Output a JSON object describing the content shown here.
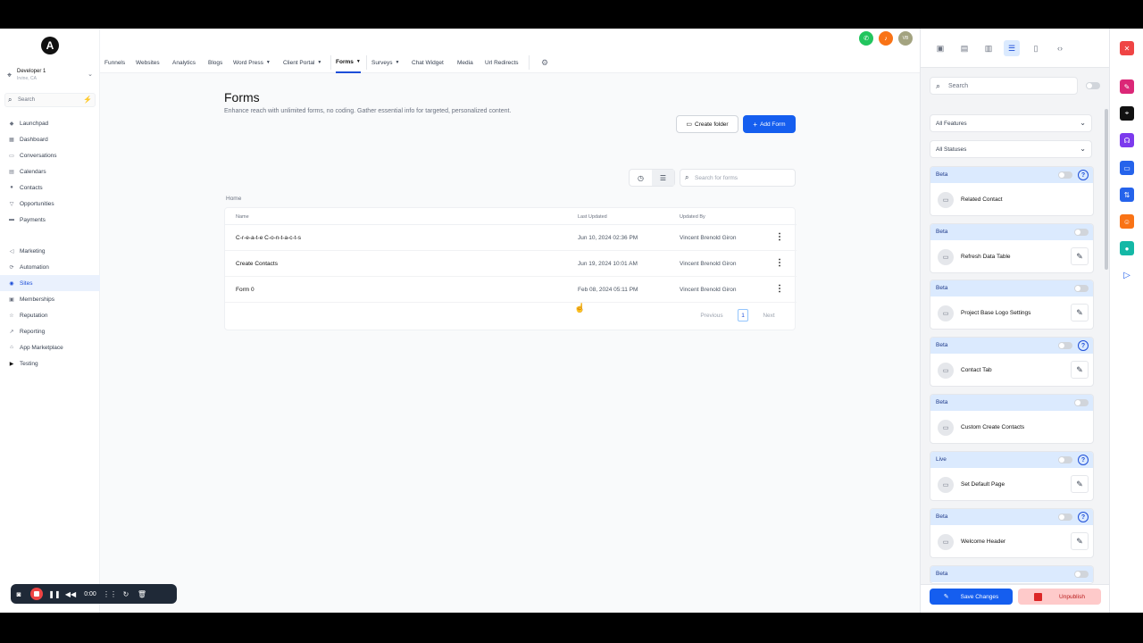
{
  "app": {
    "logo": "A"
  },
  "location": {
    "name": "Developer 1",
    "sub": "Irvine, CA"
  },
  "sidebar": {
    "search_placeholder": "Search",
    "items_top": [
      {
        "label": "Launchpad",
        "icon": "rocket-icon"
      },
      {
        "label": "Dashboard",
        "icon": "dashboard-icon"
      },
      {
        "label": "Conversations",
        "icon": "chat-icon"
      },
      {
        "label": "Calendars",
        "icon": "calendar-icon"
      },
      {
        "label": "Contacts",
        "icon": "contacts-icon"
      },
      {
        "label": "Opportunities",
        "icon": "filter-icon"
      },
      {
        "label": "Payments",
        "icon": "card-icon"
      }
    ],
    "items_bottom": [
      {
        "label": "Marketing",
        "icon": "megaphone-icon"
      },
      {
        "label": "Automation",
        "icon": "automation-icon"
      },
      {
        "label": "Sites",
        "icon": "globe-icon",
        "active": true
      },
      {
        "label": "Memberships",
        "icon": "members-icon"
      },
      {
        "label": "Reputation",
        "icon": "star-icon"
      },
      {
        "label": "Reporting",
        "icon": "chart-icon"
      },
      {
        "label": "App Marketplace",
        "icon": "store-icon"
      },
      {
        "label": "Testing",
        "icon": "youtube-icon"
      }
    ]
  },
  "topnav": {
    "items": [
      "Funnels",
      "Websites",
      "Analytics",
      "Blogs",
      "Word Press",
      "Client Portal",
      "Forms",
      "Surveys",
      "Chat Widget",
      "Media",
      "Url Redirects"
    ],
    "active": "Forms",
    "user_initials": "VB"
  },
  "main": {
    "title": "Forms",
    "subtitle": "Enhance reach with unlimited forms, no coding. Gather essential info for targeted, personalized content.",
    "create_folder": "Create folder",
    "add_form": "Add Form",
    "search_placeholder": "Search for forms",
    "breadcrumb": "Home",
    "columns": [
      "Name",
      "Last Updated",
      "Updated By"
    ],
    "rows": [
      {
        "name": "C-r-e-a-t-e C-o-n-t-a-c-t-s",
        "updated": "Jun 10, 2024 02:36 PM",
        "by": "Vincent Brenold Giron"
      },
      {
        "name": "Create Contacts",
        "updated": "Jun 19, 2024 10:01 AM",
        "by": "Vincent Brenold Giron"
      },
      {
        "name": "Form 0",
        "updated": "Feb 08, 2024 05:11 PM",
        "by": "Vincent Brenold Giron"
      }
    ],
    "pager": {
      "previous": "Previous",
      "page": "1",
      "next": "Next"
    }
  },
  "panel": {
    "search_placeholder": "Search",
    "filter_features": "All Features",
    "filter_statuses": "All Statuses",
    "cards": [
      {
        "status": "Beta",
        "title": "Related Contact",
        "help": true,
        "edit": false
      },
      {
        "status": "Beta",
        "title": "Refresh Data Table",
        "help": false,
        "edit": true
      },
      {
        "status": "Beta",
        "title": "Project Base Logo Settings",
        "help": false,
        "edit": true
      },
      {
        "status": "Beta",
        "title": "Contact Tab",
        "help": true,
        "edit": true
      },
      {
        "status": "Beta",
        "title": "Custom Create Contacts",
        "help": false,
        "edit": false
      },
      {
        "status": "Live",
        "title": "Set Default Page",
        "help": true,
        "edit": true
      },
      {
        "status": "Beta",
        "title": "Welcome Header",
        "help": true,
        "edit": true
      },
      {
        "status": "Beta",
        "title": "",
        "help": false,
        "edit": false
      }
    ],
    "save_changes": "Save Changes",
    "unpublish": "Unpublish"
  },
  "recorder": {
    "time": "0:00"
  },
  "colors": {
    "primary": "#155eef",
    "active_bg": "#eaf1fd",
    "danger": "#ef4444"
  }
}
